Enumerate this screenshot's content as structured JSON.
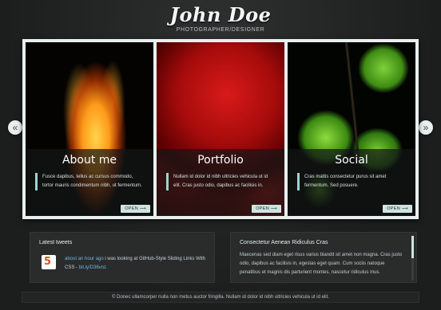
{
  "header": {
    "title": "John Doe",
    "subtitle": "PHOTOGRAPHER/DESIGNER"
  },
  "slider": {
    "prev_icon": "«",
    "next_icon": "»",
    "panels": [
      {
        "image": "fire-photo",
        "title": "About me",
        "text": "Fusce dapibus, tellus ac cursus commodo, tortor mauris condimentum nibh, ut fermentum.",
        "button": "OPEN ⟶"
      },
      {
        "image": "rose-photo",
        "title": "Portfolio",
        "text": "Nullam id dolor id nibh ultricies vehicula ut id elit. Cras justo odio, dapibus ac facilisis in.",
        "button": "OPEN ⟶"
      },
      {
        "image": "leaf-photo",
        "title": "Social",
        "text": "Cras mattis consectetur purus sit amet fermentum. Sed posuere.",
        "button": "OPEN ⟶"
      }
    ]
  },
  "tweets": {
    "title": "Latest tweets",
    "time_link": "about an hour ago",
    "text": " i was looking at GitHub-Style Sliding Links With CSS - ",
    "link": "bit.ly/D36vnz"
  },
  "text_widget": {
    "title": "Consectetur Aenean Ridiculus Cras",
    "text": "Maecenas sed diam eget risus varius blandit sit amet non magna. Cras justo odio, dapibus ac facilisis in, egestas eget quam. Cum sociis natoque penatibus et magnis dis parturient montes, nascetur ridiculus mus."
  },
  "footer": {
    "text": "© Donec ullamcorper nulla non metus auctor fringilla. Nullam id dolor id nibh ultricies vehicula ut id elit."
  },
  "colors": {
    "accent": "#9ed3d0",
    "button_bg": "#cfe3e1",
    "link": "#6fb6e0"
  }
}
